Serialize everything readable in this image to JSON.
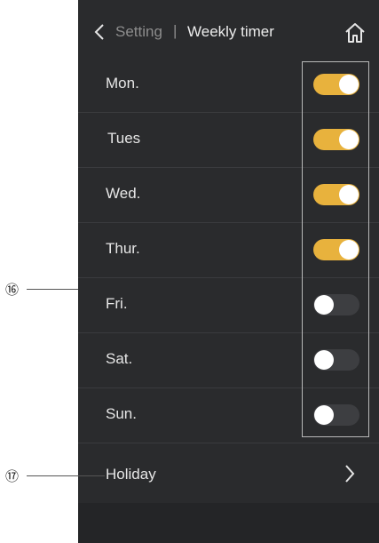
{
  "header": {
    "parent_label": "Setting",
    "separator": "|",
    "title": "Weekly timer"
  },
  "days": [
    {
      "label": "Mon.",
      "enabled": true
    },
    {
      "label": "Tues",
      "enabled": true
    },
    {
      "label": "Wed.",
      "enabled": true
    },
    {
      "label": "Thur.",
      "enabled": true
    },
    {
      "label": "Fri.",
      "enabled": false
    },
    {
      "label": "Sat.",
      "enabled": false
    },
    {
      "label": "Sun.",
      "enabled": false
    }
  ],
  "holiday": {
    "label": "Holiday"
  },
  "callouts": {
    "toggles": "⑯",
    "holiday": "⑰"
  },
  "colors": {
    "toggle_on": "#e8b23d",
    "toggle_off": "#3d3e41",
    "background": "#2a2b2d"
  },
  "icons": {
    "back": "chevron-left-icon",
    "home": "home-icon",
    "holiday_arrow": "chevron-right-icon"
  }
}
